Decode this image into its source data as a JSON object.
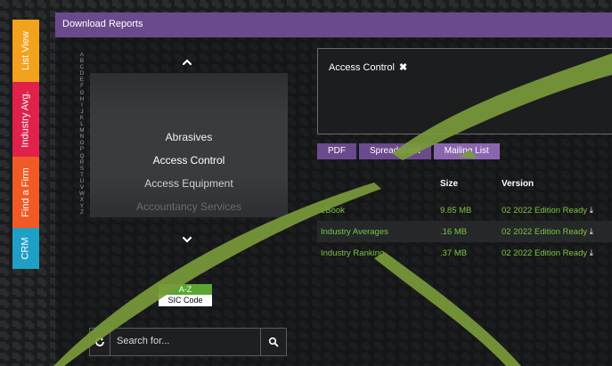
{
  "side_tabs": [
    "List View",
    "Industry Avg.",
    "Find a Firm",
    "CRM"
  ],
  "header": {
    "title": "Download Reports"
  },
  "alphabet": [
    "A",
    "B",
    "C",
    "D",
    "E",
    "F",
    "G",
    "H",
    "I",
    "J",
    "K",
    "L",
    "M",
    "N",
    "O",
    "P",
    "Q",
    "R",
    "S",
    "T",
    "U",
    "V",
    "W",
    "X",
    "Y",
    "Z"
  ],
  "industries": [
    "Abrasives",
    "Access Control",
    "Access Equipment",
    "Accountancy Services"
  ],
  "sort": {
    "az": "A-Z",
    "sic": "SIC Code"
  },
  "search": {
    "placeholder": "Search for..."
  },
  "selected": {
    "chip": "Access Control"
  },
  "format_tabs": [
    "PDF",
    "Spreadsheet",
    "Mailing List"
  ],
  "table": {
    "headers": {
      "size": "Size",
      "version": "Version"
    },
    "rows": [
      {
        "name": "eBook",
        "size": "9.85 MB",
        "version": "02 2022 Edition Ready"
      },
      {
        "name": "Industry Averages",
        "size": ".16 MB",
        "version": "02 2022 Edition Ready"
      },
      {
        "name": "Industry Ranking",
        "size": ".37 MB",
        "version": "02 2022 Edition Ready"
      }
    ]
  },
  "colors": {
    "accent_purple": "#6a4a8c",
    "download_green": "#7dc242",
    "sort_green": "#5aa630",
    "overlay_stroke": "#7a9a3a"
  }
}
